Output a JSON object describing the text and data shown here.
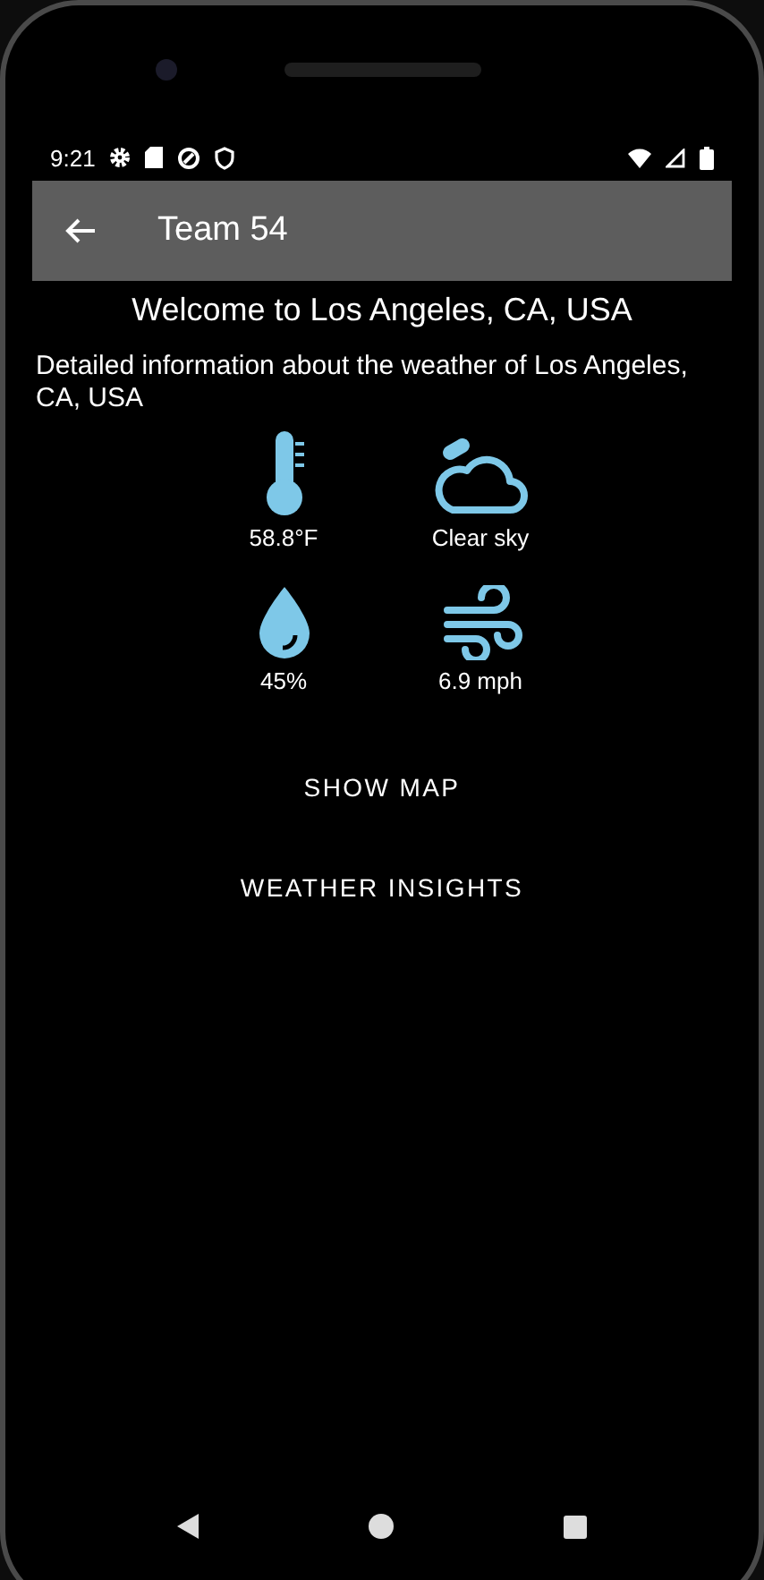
{
  "status_bar": {
    "time": "9:21"
  },
  "app_bar": {
    "title": "Team 54"
  },
  "heading": "Welcome to Los Angeles, CA, USA",
  "description": "Detailed information about the weather of Los Angeles, CA, USA",
  "conditions": [
    {
      "kind": "temperature",
      "value": "58.8°F"
    },
    {
      "kind": "sky",
      "value": "Clear sky"
    },
    {
      "kind": "humidity",
      "value": "45%"
    },
    {
      "kind": "wind",
      "value": "6.9 mph"
    }
  ],
  "buttons": [
    "SHOW MAP",
    "WEATHER INSIGHTS"
  ]
}
